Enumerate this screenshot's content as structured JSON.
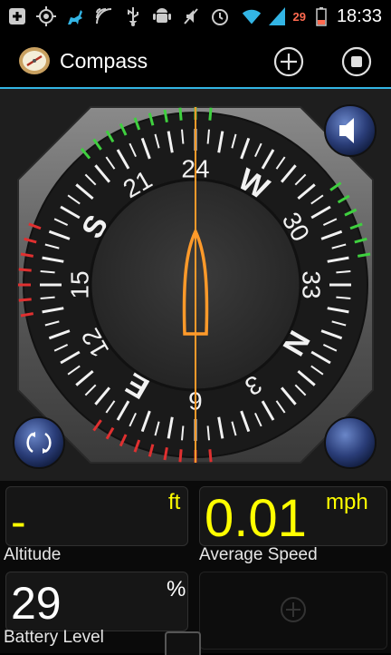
{
  "status_bar": {
    "battery_percent": "29",
    "time": "18:33",
    "icons": [
      "add-box-icon",
      "gps-icon",
      "deer-icon",
      "feed-icon",
      "usb-icon",
      "android-icon",
      "mute-icon",
      "alarm-icon",
      "wifi-icon",
      "signal-icon",
      "battery-icon"
    ]
  },
  "action_bar": {
    "title": "Compass",
    "actions": [
      "add-icon",
      "stop-icon"
    ],
    "accent_color": "#33b5e5"
  },
  "compass": {
    "ring_labels": {
      "N": "N",
      "E": "E",
      "S": "S",
      "W": "W",
      "d3": "3",
      "d6": "6",
      "d12": "12",
      "d15": "15",
      "d21": "21",
      "d24": "24",
      "d30": "30",
      "d33": "33"
    },
    "heading_degrees": 240,
    "needle_color": "#ff9a2a",
    "buttons": [
      "sound-button",
      "rotate-lock-button",
      "blank-button"
    ]
  },
  "widgets": {
    "altitude": {
      "value": "-",
      "unit": "ft",
      "label": "Altitude"
    },
    "average_speed": {
      "value": "0.01",
      "unit": "mph",
      "label": "Average Speed"
    },
    "battery": {
      "value": "29",
      "unit": "%",
      "label": "Battery Level"
    },
    "empty_slot": {
      "icon": "add-icon"
    }
  }
}
